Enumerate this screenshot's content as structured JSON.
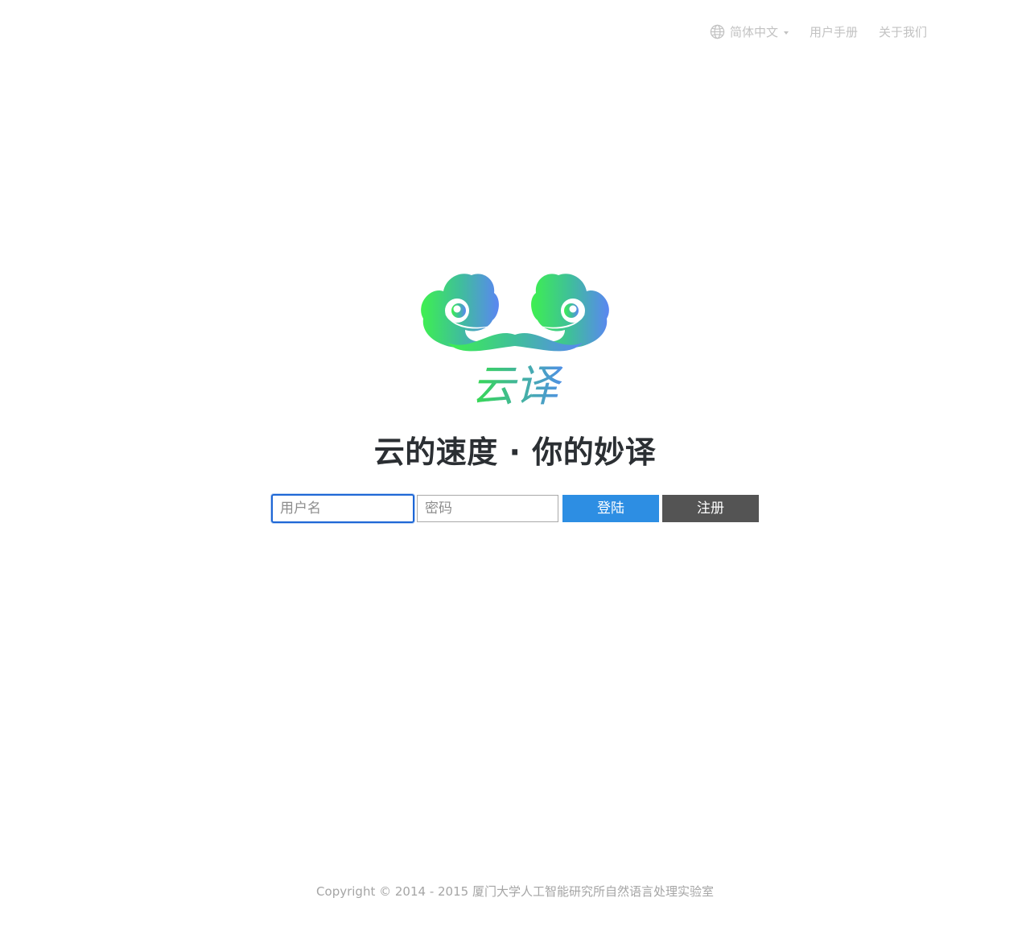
{
  "header": {
    "language": {
      "label": "简体中文",
      "icon": "globe-icon"
    },
    "links": [
      {
        "label": "用户手册"
      },
      {
        "label": "关于我们"
      }
    ]
  },
  "logo": {
    "text": "云译",
    "gradient_start": "#3de05a",
    "gradient_end": "#5a8cf0"
  },
  "slogan": "云的速度 · 你的妙译",
  "form": {
    "username_placeholder": "用户名",
    "password_placeholder": "密码",
    "login_label": "登陆",
    "register_label": "注册",
    "login_color": "#2d8ee3",
    "register_color": "#545454"
  },
  "footer": {
    "copyright": "Copyright © 2014 - 2015 厦门大学人工智能研究所自然语言处理实验室"
  }
}
